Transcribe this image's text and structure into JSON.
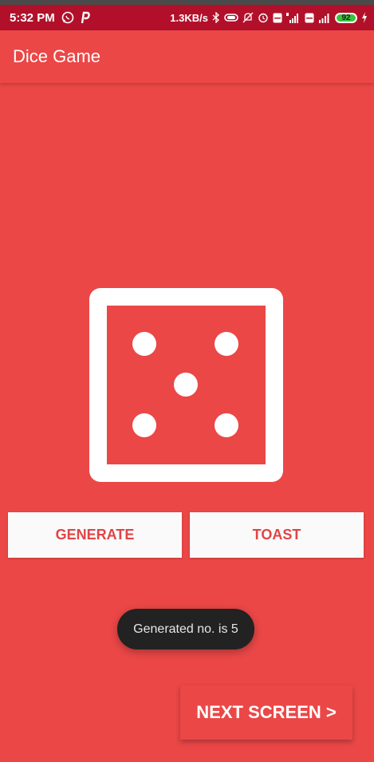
{
  "status_bar": {
    "time": "5:32 PM",
    "network_speed": "1.3KB/s",
    "battery_level": "92",
    "icons": [
      "whatsapp-icon",
      "p-app-icon",
      "bluetooth-icon",
      "headset-icon",
      "silent-icon",
      "alarm-icon",
      "volte-icon",
      "signal-4g-icon",
      "volte-icon",
      "signal-icon",
      "battery-icon",
      "charging-icon"
    ]
  },
  "app_bar": {
    "title": "Dice Game"
  },
  "dice": {
    "face_value": 5
  },
  "buttons": {
    "generate_label": "GENERATE",
    "toast_label": "TOAST",
    "next_label": "NEXT SCREEN >"
  },
  "toast": {
    "message": "Generated no. is 5"
  },
  "colors": {
    "background": "#eb4747",
    "status_bar": "#b2102a",
    "button_text": "#e04545",
    "button_bg": "#fafafa",
    "toast_bg": "#222222"
  }
}
